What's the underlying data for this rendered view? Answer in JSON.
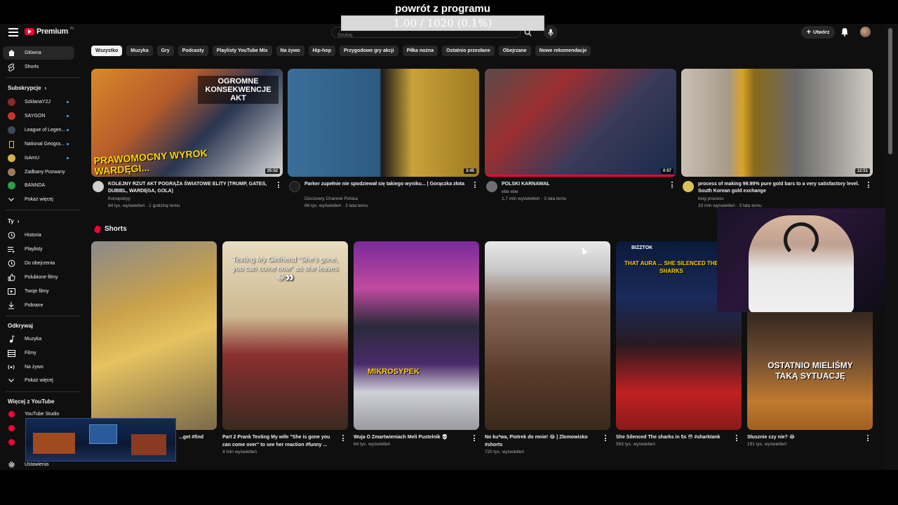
{
  "overlay": {
    "title": "powrót z programu",
    "progress_text": "1.00 / 1020 (0.1%)",
    "progress_fraction": 0.001
  },
  "header": {
    "logo_text": "Premium",
    "logo_country": "PL",
    "search_placeholder": "Szukaj",
    "create_label": "Utwórz"
  },
  "sidebar": {
    "home": "Główna",
    "shorts": "Shorts",
    "subscriptions_heading": "Subskrypcje",
    "subscriptions": [
      {
        "name": "SzklanaY2J",
        "color": "#8a2b2b"
      },
      {
        "name": "SAYGON",
        "color": "#c2362b"
      },
      {
        "name": "League of Legen...",
        "color": "#3d4a5c"
      },
      {
        "name": "National Geogra...",
        "color": "#f5c400"
      },
      {
        "name": "IsAmU",
        "color": "#d8b24a"
      },
      {
        "name": "Zadbany Pozwany",
        "color": "#9e7a5c"
      },
      {
        "name": "BANNDA",
        "color": "#2e9e4a"
      }
    ],
    "show_more": "Pokaż więcej",
    "you_heading": "Ty",
    "you_items": [
      "Historia",
      "Playlisty",
      "Do obejrzenia",
      "Polubione filmy",
      "Twoje filmy",
      "Pobrane"
    ],
    "explore_heading": "Odkrywaj",
    "explore_items": [
      "Muzyka",
      "Filmy",
      "Na żywo",
      "Pokaż więcej"
    ],
    "more_heading": "Więcej z YouTube",
    "more_items": [
      "YouTube Studio"
    ],
    "settings": "Ustawienia"
  },
  "chips": [
    "Wszystko",
    "Muzyka",
    "Gry",
    "Podcasty",
    "Playlisty YouTube Mix",
    "Na żywo",
    "Hip-hop",
    "Przygodowe gry akcji",
    "Piłka nożna",
    "Ostatnio przesłane",
    "Obejrzane",
    "Nowe rekomendacje"
  ],
  "videos": [
    {
      "title": "KOLEJNY RZUT AKT POGRĄŻA ŚWIATOWE ELITY (TRUMP, GATES, DUBIEL, WARDĘGA, GOLA)",
      "channel": "Konopskyy",
      "meta": "84 tys. wyświetleń · 1 godzinę temu",
      "duration": "35:52",
      "thumb_text_top": "OGROMNE KONSEKWENCJE AKT",
      "thumb_text_bottom": "PRAWOMOCNY WYROK WARDĘGI...",
      "avatar_color": "#cfcfcf"
    },
    {
      "title": "Parker zupełnie nie spodziewał się takiego wyniku... | Gorączka złota",
      "channel": "Discovery Channel Polska",
      "meta": "66 tys. wyświetleń · 3 lata temu",
      "duration": "3:45",
      "avatar_color": "#1f1f1f"
    },
    {
      "title": "POLSKI KARNAWAŁ",
      "channel": "ebe ebe",
      "meta": "1,7 mln wyświetleń · 3 lata temu",
      "duration": "0:57",
      "avatar_color": "#6f6f6f"
    },
    {
      "title": "process of making 99.99% pure gold bars to a very satisfactory level. South Korean gold exchange",
      "channel": "king process",
      "meta": "33 mln wyświetleń · 3 lata temu",
      "duration": "12:51",
      "avatar_color": "#d9c25a"
    }
  ],
  "shorts_heading": "Shorts",
  "shorts": [
    {
      "title": "...get #find",
      "views": "",
      "color1": "#c9a14a",
      "color2": "#7a6a4a"
    },
    {
      "title": "Part 2 Prank Texting My wife \"She is gone you can come over\" to see her reaction #funny ...",
      "views": "4 mln wyświetleń",
      "overlay": "Texting My Girlfriend \"She's gone, you can come now\" as she leaves 😂👀",
      "color1": "#d8c8a8",
      "color2": "#8a3030"
    },
    {
      "title": "Wuja O Zmartwieniach Meli Pustelnik 💀",
      "views": "64 tys. wyświetleń",
      "overlay": "MIKROSYPEK",
      "color1": "#6a2a8a",
      "color2": "#2a2a3a"
    },
    {
      "title": "No ku*wa, Piotrek do mnie! 😂 | Złomowisko #shorts",
      "views": "720 tys. wyświetleń",
      "color1": "#d0d0d0",
      "color2": "#5a3a2a"
    },
    {
      "title": "She Silenced The sharks in 5s 😳 #sharktank",
      "views": "563 tys. wyświetleń",
      "overlay": "THAT AURA ... SHE SILENCED THE SHARKS",
      "badge": "BIZZTOK",
      "color1": "#0a1a3a",
      "color2": "#c02020"
    },
    {
      "title": "Słusznie czy nie? 😂",
      "views": "191 tys. wyświetleń",
      "overlay": "OSTATNIO MIELIŚMY TAKĄ SYTUACJĘ",
      "color1": "#3a2a20",
      "color2": "#c07a30"
    }
  ],
  "colors": {
    "accent": "#ff0033",
    "background": "#0f0f0f",
    "chip": "#272727"
  }
}
